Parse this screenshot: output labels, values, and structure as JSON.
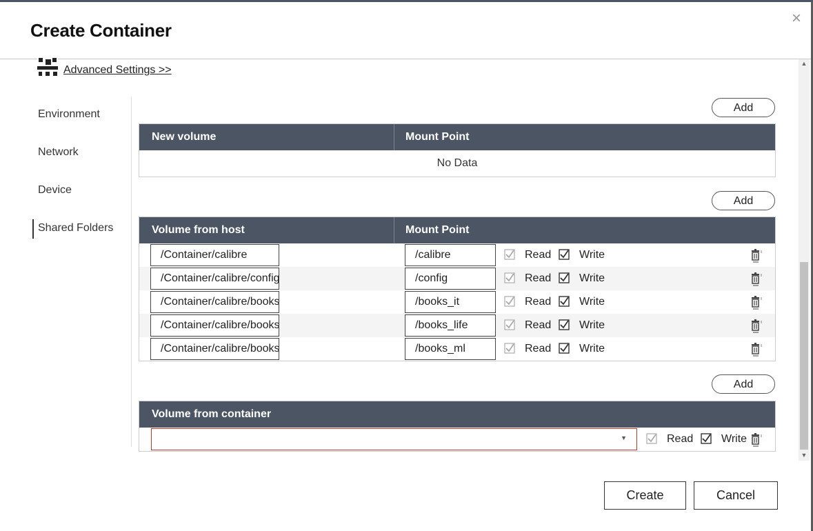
{
  "dialog": {
    "title": "Create Container",
    "close_icon": "×"
  },
  "advanced": {
    "link": "Advanced Settings >>"
  },
  "nav": {
    "items": [
      "Environment",
      "Network",
      "Device",
      "Shared Folders"
    ],
    "active": "Shared Folders"
  },
  "new_volume": {
    "add_label": "Add",
    "headers": [
      "New volume",
      "Mount Point"
    ],
    "empty": "No Data"
  },
  "host_volume": {
    "add_label": "Add",
    "headers": [
      "Volume from host",
      "Mount Point"
    ],
    "rows": [
      {
        "host": "/Container/calibre",
        "mount": "/calibre",
        "read_label": "Read",
        "write_label": "Write",
        "read": true,
        "write": true
      },
      {
        "host": "/Container/calibre/config",
        "mount": "/config",
        "read_label": "Read",
        "write_label": "Write",
        "read": true,
        "write": true
      },
      {
        "host": "/Container/calibre/books_it",
        "mount": "/books_it",
        "read_label": "Read",
        "write_label": "Write",
        "read": true,
        "write": true
      },
      {
        "host": "/Container/calibre/books_life",
        "mount": "/books_life",
        "read_label": "Read",
        "write_label": "Write",
        "read": true,
        "write": true
      },
      {
        "host": "/Container/calibre/books_ml",
        "mount": "/books_ml",
        "read_label": "Read",
        "write_label": "Write",
        "read": true,
        "write": true
      }
    ]
  },
  "container_volume": {
    "add_label": "Add",
    "header": "Volume from container",
    "select_value": "",
    "read_label": "Read",
    "write_label": "Write"
  },
  "footer": {
    "create_label": "Create",
    "cancel_label": "Cancel"
  }
}
